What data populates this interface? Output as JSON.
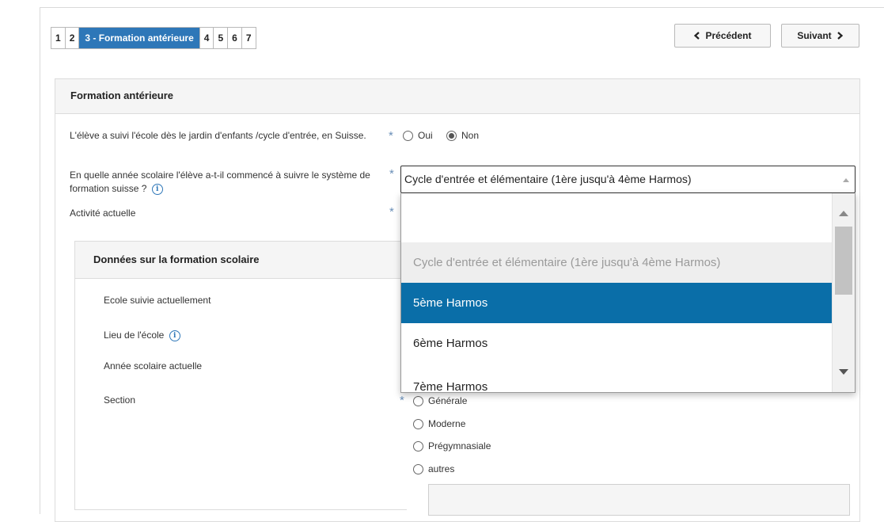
{
  "stepper": {
    "steps": [
      "1",
      "2",
      "3 - Formation antérieure",
      "4",
      "5",
      "6",
      "7"
    ],
    "active_index": 2
  },
  "nav": {
    "previous_label": "Précédent",
    "next_label": "Suivant"
  },
  "panel": {
    "title": "Formation antérieure"
  },
  "questions": {
    "kindergarten": {
      "label": "L'élève a suivi l'école dès le jardin d'enfants /cycle d'entrée, en Suisse.",
      "options": [
        "Oui",
        "Non"
      ],
      "selected": "Non"
    },
    "start_year": {
      "label": "En quelle année scolaire l'élève a-t-il commencé à suivre le système de formation suisse ?",
      "value": "Cycle d'entrée et élémentaire (1ère jusqu'à 4ème Harmos)"
    },
    "current_activity": {
      "label": "Activité actuelle"
    }
  },
  "required_marker": "*",
  "info_icon_glyph": "i",
  "dropdown": {
    "options": [
      "",
      "Cycle d'entrée et élémentaire (1ère jusqu'à 4ème Harmos)",
      "5ème Harmos",
      "6ème Harmos",
      "7ème Harmos"
    ],
    "disabled_index": 1,
    "highlighted_index": 2
  },
  "school_data": {
    "title": "Données sur la formation scolaire",
    "fields": {
      "school": "Ecole suivie actuellement",
      "location": "Lieu de l'école",
      "year": "Année scolaire actuelle",
      "section": "Section"
    },
    "section_options": [
      "Générale",
      "Moderne",
      "Prégymnasiale",
      "autres"
    ]
  },
  "colors": {
    "accent": "#2e77b8",
    "highlight": "#0a6ea8",
    "required": "#6a8fb8"
  }
}
